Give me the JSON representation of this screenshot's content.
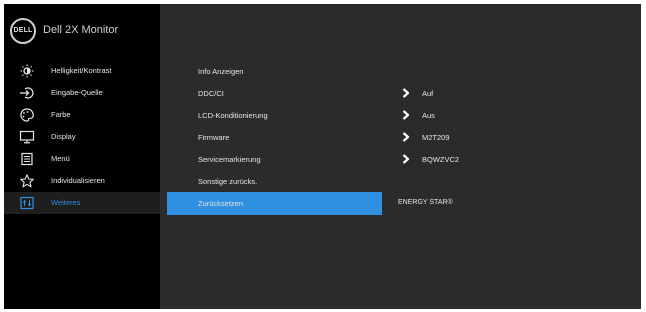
{
  "brand": {
    "logo_text": "DELL",
    "title": "Dell 2X Monitor"
  },
  "sidebar": {
    "items": [
      {
        "label": "Helligkeit/Kontrast",
        "icon": "brightness-icon"
      },
      {
        "label": "Eingabe-Quelle",
        "icon": "input-source-icon"
      },
      {
        "label": "Farbe",
        "icon": "color-palette-icon"
      },
      {
        "label": "Display",
        "icon": "display-icon"
      },
      {
        "label": "Menü",
        "icon": "menu-icon"
      },
      {
        "label": "Individualisieren",
        "icon": "star-icon"
      },
      {
        "label": "Weiteres",
        "icon": "others-icon",
        "active": true
      }
    ]
  },
  "main": {
    "rows": [
      {
        "label": "Info Anzeigen"
      },
      {
        "label": "DDC/CI",
        "value": "Auf"
      },
      {
        "label": "LCD-Konditionierung",
        "value": "Aus"
      },
      {
        "label": "Firmware",
        "value": "M2T209"
      },
      {
        "label": "Servicemarkierung",
        "value": "BQWZVC2"
      },
      {
        "label": "Sonstige zurücks."
      },
      {
        "label": "Zurücksetzen",
        "extra": "ENERGY STAR®",
        "selected": true
      }
    ]
  },
  "colors": {
    "accent": "#2f8fe0",
    "panel": "#2b2b2b",
    "sidebar": "#000000"
  }
}
